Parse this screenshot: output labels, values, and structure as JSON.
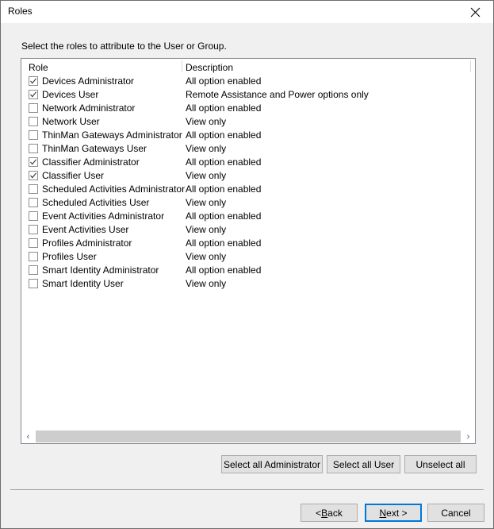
{
  "window": {
    "title": "Roles",
    "close_icon": "close-icon"
  },
  "instruction": "Select the roles to attribute to the User or Group.",
  "list": {
    "columns": {
      "role": "Role",
      "description": "Description"
    },
    "rows": [
      {
        "checked": true,
        "role": "Devices Administrator",
        "description": "All option enabled"
      },
      {
        "checked": true,
        "role": "Devices User",
        "description": "Remote Assistance and Power options only"
      },
      {
        "checked": false,
        "role": "Network Administrator",
        "description": "All option enabled"
      },
      {
        "checked": false,
        "role": "Network User",
        "description": "View only"
      },
      {
        "checked": false,
        "role": "ThinMan Gateways Administrator",
        "description": "All option enabled"
      },
      {
        "checked": false,
        "role": "ThinMan Gateways User",
        "description": "View only"
      },
      {
        "checked": true,
        "role": "Classifier Administrator",
        "description": "All option enabled"
      },
      {
        "checked": true,
        "role": "Classifier User",
        "description": "View only"
      },
      {
        "checked": false,
        "role": "Scheduled Activities Administrator",
        "description": "All option enabled"
      },
      {
        "checked": false,
        "role": "Scheduled Activities User",
        "description": "View only"
      },
      {
        "checked": false,
        "role": "Event Activities Administrator",
        "description": "All option enabled"
      },
      {
        "checked": false,
        "role": "Event Activities User",
        "description": "View only"
      },
      {
        "checked": false,
        "role": "Profiles Administrator",
        "description": "All option enabled"
      },
      {
        "checked": false,
        "role": "Profiles User",
        "description": "View only"
      },
      {
        "checked": false,
        "role": "Smart Identity Administrator",
        "description": "All option enabled"
      },
      {
        "checked": false,
        "role": "Smart Identity User",
        "description": "View only"
      }
    ],
    "scrollbar": {
      "left_arrow": "‹",
      "right_arrow": "›"
    }
  },
  "select_buttons": {
    "select_all_administrator": "Select all Administrator",
    "select_all_user": "Select all User",
    "unselect_all": "Unselect all"
  },
  "footer_buttons": {
    "back_prefix": "< ",
    "back_accel": "B",
    "back_suffix": "ack",
    "next_accel": "N",
    "next_suffix": "ext >",
    "cancel": "Cancel"
  },
  "colors": {
    "dialog_background": "#f0f0f0",
    "titlebar_background": "#ffffff",
    "list_background": "#ffffff",
    "list_border": "#828790",
    "button_face": "#e1e1e1",
    "button_border": "#adadad",
    "focus_border": "#0078d7",
    "scroll_thumb": "#cdcdcd",
    "text": "#000000"
  }
}
